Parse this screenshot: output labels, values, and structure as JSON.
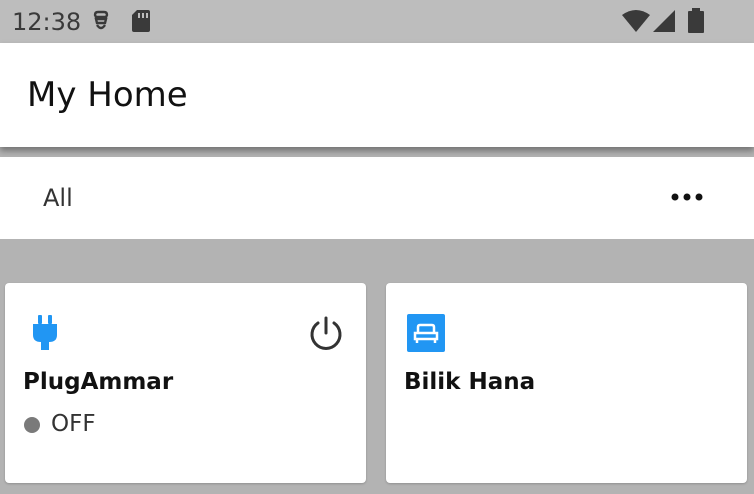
{
  "status_bar": {
    "time": "12:38",
    "icons": [
      "app-notification-icon",
      "sd-card-icon",
      "wifi-icon",
      "cellular-signal-icon",
      "battery-icon"
    ]
  },
  "app_bar": {
    "title": "My Home"
  },
  "filter_bar": {
    "selected": "All",
    "more_icon": "more-horizontal-icon"
  },
  "devices": [
    {
      "name": "PlugAmmar",
      "icon": "plug-icon",
      "icon_color": "#2196f3",
      "status": "OFF",
      "status_color": "#7a7a7a",
      "action_icon": "power-icon"
    },
    {
      "name": "Bilik Hana",
      "icon": "bed-icon",
      "icon_color": "#2196f3"
    }
  ],
  "colors": {
    "accent": "#2196f3",
    "background": "#b3b3b3",
    "status_bar": "#bdbdbd",
    "card": "#ffffff"
  }
}
